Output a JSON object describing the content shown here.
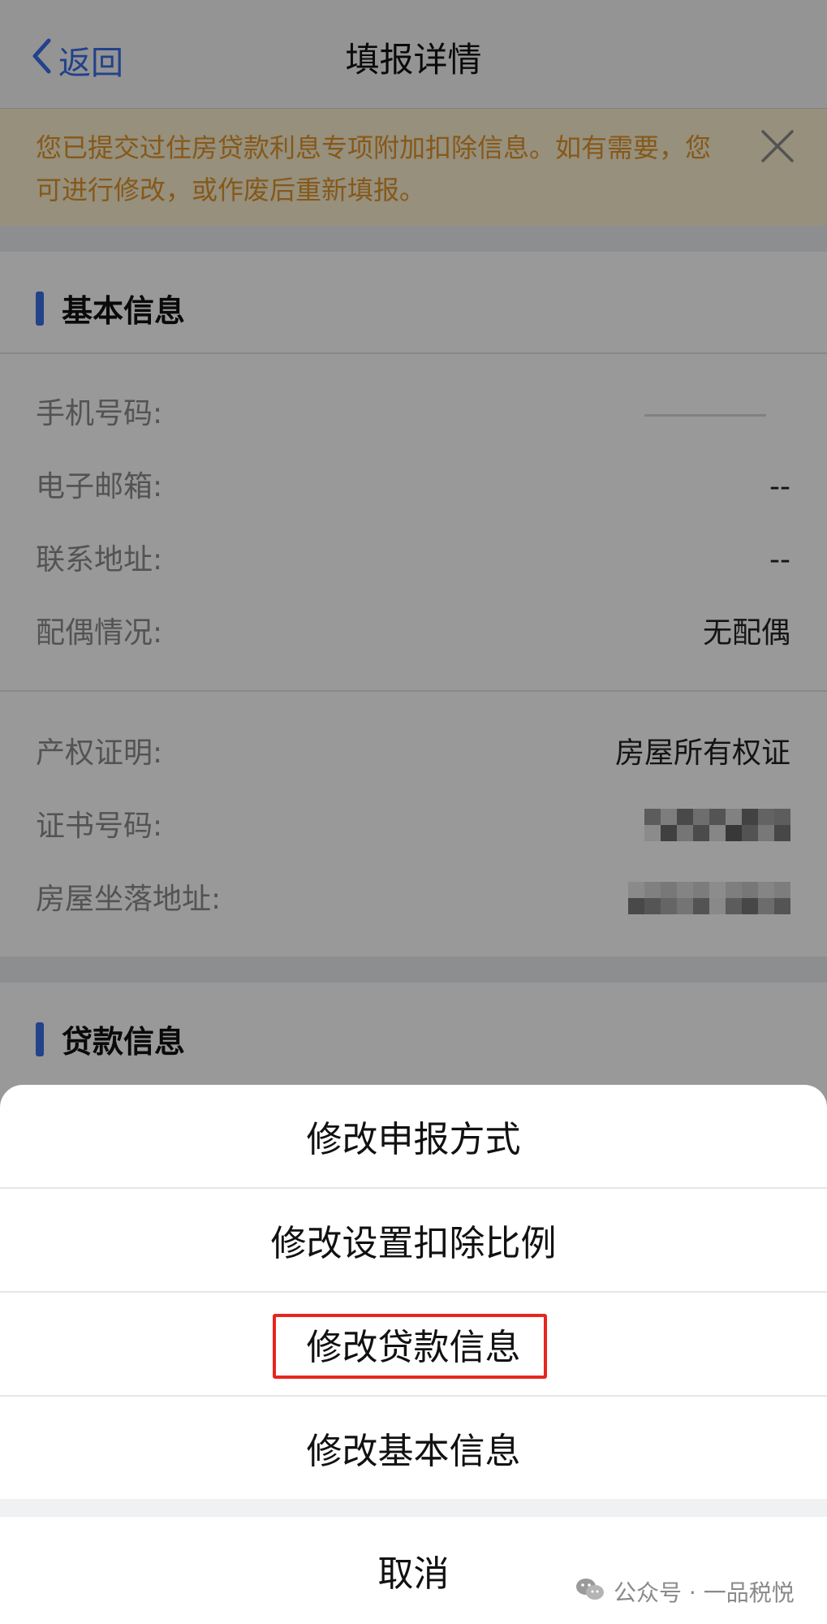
{
  "nav": {
    "back_label": "返回",
    "title": "填报详情"
  },
  "notice": {
    "text": "您已提交过住房贷款利息专项附加扣除信息。如有需要，您可进行修改，或作废后重新填报。"
  },
  "basic_info": {
    "section_title": "基本信息",
    "rows": [
      {
        "label": "手机号码:",
        "value": ""
      },
      {
        "label": "电子邮箱:",
        "value": "--"
      },
      {
        "label": "联系地址:",
        "value": "--"
      },
      {
        "label": "配偶情况:",
        "value": "无配偶"
      }
    ],
    "property_rows": [
      {
        "label": "产权证明:",
        "value": "房屋所有权证"
      },
      {
        "label": "证书号码:",
        "value": ""
      },
      {
        "label": "房屋坐落地址:",
        "value": ""
      }
    ]
  },
  "loan_info": {
    "section_title": "贷款信息"
  },
  "action_sheet": {
    "items": [
      {
        "label": "修改申报方式"
      },
      {
        "label": "修改设置扣除比例"
      },
      {
        "label": "修改贷款信息",
        "highlighted": true
      },
      {
        "label": "修改基本信息"
      }
    ],
    "cancel_label": "取消"
  },
  "watermark": {
    "text": "公众号 · 一品税悦"
  },
  "colors": {
    "accent": "#3a6fe6",
    "notice_text": "#e0932a",
    "notice_bg": "#fbf1d0",
    "highlight": "#e8251f"
  }
}
